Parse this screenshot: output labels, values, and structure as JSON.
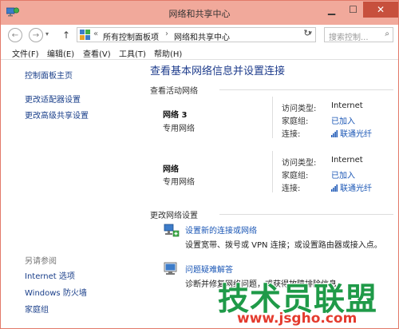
{
  "window": {
    "title": "网络和共享中心"
  },
  "address": {
    "prefix": "«",
    "crumb1": "所有控制面板项",
    "crumb2": "网络和共享中心",
    "search_placeholder": "搜索控制..."
  },
  "menu": [
    "文件(F)",
    "编辑(E)",
    "查看(V)",
    "工具(T)",
    "帮助(H)"
  ],
  "sidebar": {
    "home": "控制面板主页",
    "links": [
      "更改适配器设置",
      "更改高级共享设置"
    ],
    "see_also_heading": "另请参阅",
    "see_also": [
      "Internet 选项",
      "Windows 防火墙",
      "家庭组"
    ]
  },
  "main": {
    "title": "查看基本网络信息并设置连接",
    "active_heading": "查看活动网络",
    "networks": [
      {
        "name": "网络  3",
        "type": "专用网络",
        "access_label": "访问类型:",
        "access_value": "Internet",
        "homegroup_label": "家庭组:",
        "homegroup_value": "已加入",
        "connection_label": "连接:",
        "connection_value": "联通光纤"
      },
      {
        "name": "网络",
        "type": "专用网络",
        "access_label": "访问类型:",
        "access_value": "Internet",
        "homegroup_label": "家庭组:",
        "homegroup_value": "已加入",
        "connection_label": "连接:",
        "connection_value": "联通光纤"
      }
    ],
    "change_heading": "更改网络设置",
    "tasks": [
      {
        "link": "设置新的连接或网络",
        "desc": "设置宽带、拨号或 VPN 连接；或设置路由器或接入点。"
      },
      {
        "link": "问题疑难解答",
        "desc": "诊断并修复网络问题，或获得故障排除信息。"
      }
    ]
  },
  "watermark": {
    "text": "技术员联盟",
    "url": "www.jsgho.com"
  }
}
